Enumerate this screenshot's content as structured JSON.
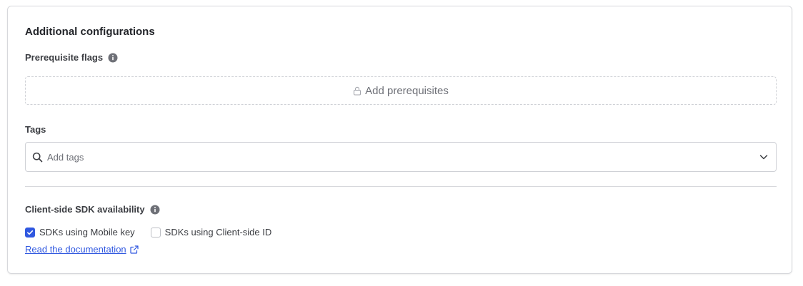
{
  "panel": {
    "title": "Additional configurations"
  },
  "prerequisites": {
    "label": "Prerequisite flags",
    "info_icon": "info-icon",
    "add_button_label": "Add prerequisites",
    "add_button_icon": "lock-icon"
  },
  "tags": {
    "label": "Tags",
    "placeholder": "Add tags",
    "value": "",
    "search_icon": "search-icon",
    "dropdown_icon": "chevron-down-icon"
  },
  "sdk_availability": {
    "label": "Client-side SDK availability",
    "info_icon": "info-icon",
    "options": [
      {
        "label": "SDKs using Mobile key",
        "checked": true
      },
      {
        "label": "SDKs using Client-side ID",
        "checked": false
      }
    ],
    "doc_link_label": "Read the documentation",
    "doc_link_icon": "external-link-icon"
  },
  "colors": {
    "accent": "#3058e0",
    "border": "#d7d8dc",
    "text": "#23252a",
    "muted_text": "#6e7077"
  }
}
